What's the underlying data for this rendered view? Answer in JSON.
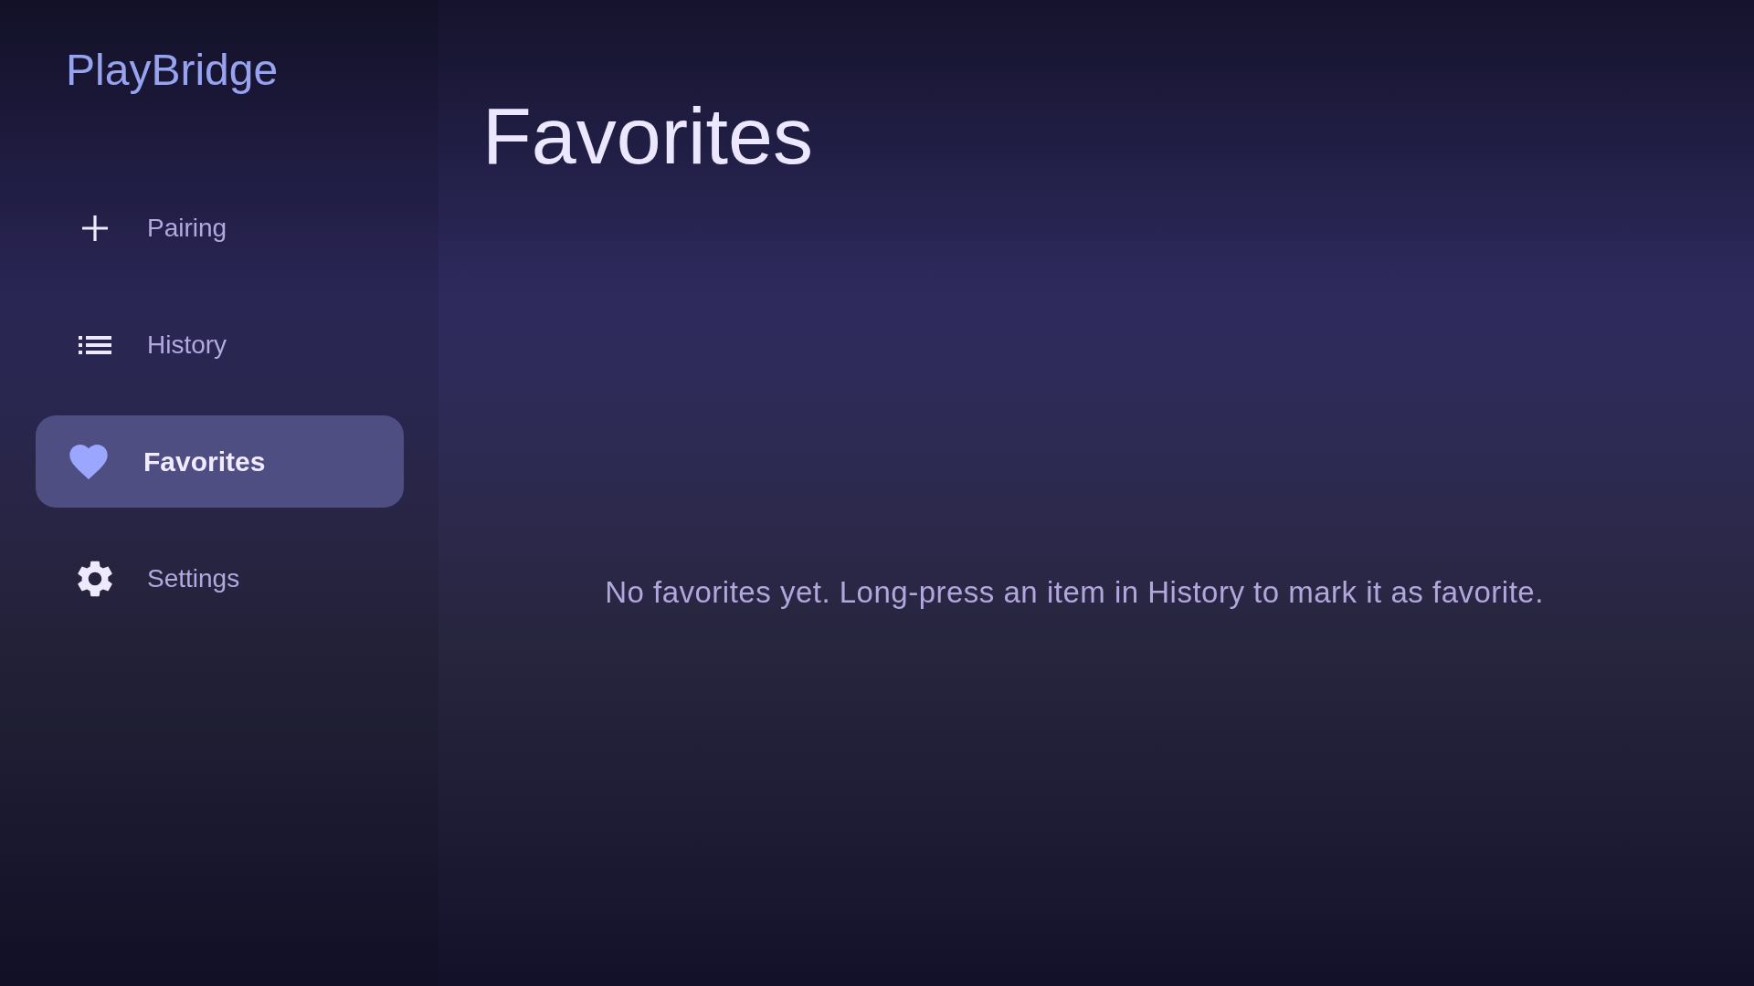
{
  "app": {
    "logo": "PlayBridge"
  },
  "sidebar": {
    "items": [
      {
        "label": "Pairing",
        "selected": false
      },
      {
        "label": "History",
        "selected": false
      },
      {
        "label": "Favorites",
        "selected": true
      },
      {
        "label": "Settings",
        "selected": false
      }
    ]
  },
  "page": {
    "title": "Favorites",
    "empty_message": "No favorites yet. Long-press an item in History to mark it as favorite."
  }
}
